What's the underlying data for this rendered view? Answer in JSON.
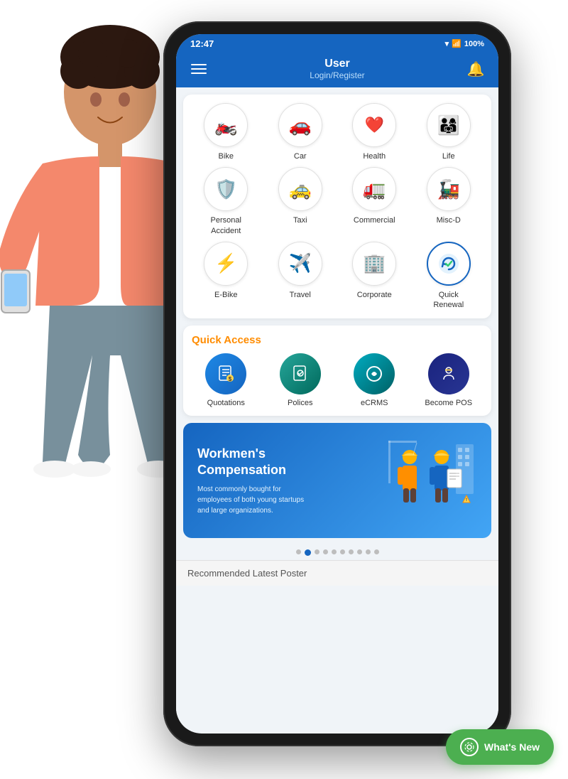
{
  "status_bar": {
    "time": "12:47",
    "battery": "100%"
  },
  "header": {
    "title": "User",
    "subtitle": "Login/Register"
  },
  "insurance_items": [
    {
      "id": "bike",
      "label": "Bike",
      "emoji": "🏍️"
    },
    {
      "id": "car",
      "label": "Car",
      "emoji": "🚗"
    },
    {
      "id": "health",
      "label": "Health",
      "emoji": "❤️"
    },
    {
      "id": "life",
      "label": "Life",
      "emoji": "👨‍👩‍👧"
    },
    {
      "id": "personal-accident",
      "label": "Personal\nAccident",
      "emoji": "🛡️"
    },
    {
      "id": "taxi",
      "label": "Taxi",
      "emoji": "🚕"
    },
    {
      "id": "commercial",
      "label": "Commercial",
      "emoji": "🚛"
    },
    {
      "id": "misc-d",
      "label": "Misc-D",
      "emoji": "🚂"
    },
    {
      "id": "e-bike",
      "label": "E-Bike",
      "emoji": "⚡"
    },
    {
      "id": "travel",
      "label": "Travel",
      "emoji": "✈️"
    },
    {
      "id": "corporate",
      "label": "Corporate",
      "emoji": "🏢"
    },
    {
      "id": "quick-renewal",
      "label": "Quick Renewal",
      "emoji": "✅"
    }
  ],
  "quick_access": {
    "title": "Quick Access",
    "items": [
      {
        "id": "quotations",
        "label": "Quotations",
        "emoji": "📋"
      },
      {
        "id": "polices",
        "label": "Polices",
        "emoji": "📄"
      },
      {
        "id": "ecrms",
        "label": "eCRMS",
        "emoji": "🔵"
      },
      {
        "id": "become-pos",
        "label": "Become POS",
        "emoji": "👷"
      }
    ]
  },
  "banner": {
    "title": "Workmen's\nCompensation",
    "description": "Most commonly bought for employees of both young startups and large organizations.",
    "illustration": "👷"
  },
  "dots": {
    "total": 10,
    "active_index": 1
  },
  "bottom": {
    "text": "Recommended Latest Poster"
  },
  "whats_new": {
    "label": "What's New"
  }
}
